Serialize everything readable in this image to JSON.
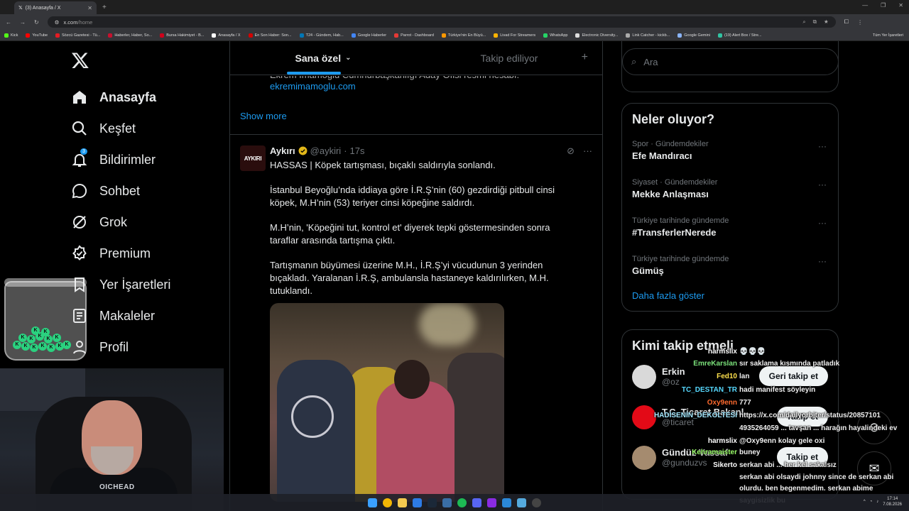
{
  "browser": {
    "tab_title": "(3) Anasayfa / X",
    "url_domain": "x.com",
    "url_path": "/home",
    "bookmarks": [
      {
        "label": "Kick",
        "color": "#53fc18"
      },
      {
        "label": "YouTube",
        "color": "#ff0000"
      },
      {
        "label": "Sözcü Gazetesi - Tü...",
        "color": "#e41b23"
      },
      {
        "label": "Haberler, Haber, So...",
        "color": "#c8102e"
      },
      {
        "label": "Bursa Hakimiyet - B...",
        "color": "#d0021b"
      },
      {
        "label": "Anasayfa / X",
        "color": "#ffffff"
      },
      {
        "label": "En Son Haber: Son...",
        "color": "#d40000"
      },
      {
        "label": "T24 - Gündem, Hab...",
        "color": "#0077b6"
      },
      {
        "label": "Google Haberler",
        "color": "#4285f4"
      },
      {
        "label": "Parrot - Dashboard",
        "color": "#e53935"
      },
      {
        "label": "Türkiye'nin En Büyü...",
        "color": "#ff9800"
      },
      {
        "label": "Livad For Streamers",
        "color": "#ffb300"
      },
      {
        "label": "WhatsApp",
        "color": "#25d366"
      },
      {
        "label": "Electronic Diversity...",
        "color": "#dddddd"
      },
      {
        "label": "Link Catcher - kickb...",
        "color": "#aaaaaa"
      },
      {
        "label": "Google Gemini",
        "color": "#8ab4f8"
      },
      {
        "label": "(19) Alert Box / Stre...",
        "color": "#31c3a2"
      }
    ],
    "all_bookmarks": "Tüm Yer İşaretleri"
  },
  "nav": {
    "items": [
      {
        "label": "Anasayfa",
        "icon": "home-icon"
      },
      {
        "label": "Keşfet",
        "icon": "search-icon"
      },
      {
        "label": "Bildirimler",
        "icon": "bell-icon",
        "badge": "3"
      },
      {
        "label": "Sohbet",
        "icon": "chat-icon"
      },
      {
        "label": "Grok",
        "icon": "grok-icon"
      },
      {
        "label": "Premium",
        "icon": "premium-icon"
      },
      {
        "label": "Yer İşaretleri",
        "icon": "bookmark-icon"
      },
      {
        "label": "Makaleler",
        "icon": "article-icon"
      },
      {
        "label": "Profil",
        "icon": "profile-icon"
      }
    ]
  },
  "feed": {
    "tabs": [
      "Sana özel",
      "Takip ediliyor"
    ],
    "prev_post_cut": "Ekrem İmamoğlu Cumhurbaşkanlığı Aday Ofisi resmi hesabı.",
    "prev_post_link": "ekremimamoglu.com",
    "show_more": "Show more",
    "post": {
      "avatar_text": "AYKIRI",
      "name": "Aykırı",
      "handle": "@aykiri",
      "time": "17s",
      "paragraphs": [
        "HASSAS | Köpek tartışması, bıçaklı saldırıyla sonlandı.",
        "İstanbul Beyoğlu’nda iddiaya göre İ.R.Ş’nin (60) gezdirdiği pitbull cinsi köpek, M.H’nin (53) teriyer cinsi köpeğine saldırdı.",
        "M.H’nin, 'Köpeğini tut, kontrol et' diyerek tepki göstermesinden sonra taraflar arasında tartışma çıktı.",
        "Tartışmanın büyümesi üzerine M.H., İ.R.Ş’yi vücudunun 3 yerinden bıçakladı. Yaralanan İ.R.Ş, ambulansla hastaneye kaldırılırken, M.H. tutuklandı."
      ]
    }
  },
  "sidebar": {
    "search_placeholder": "Ara",
    "trends_title": "Neler oluyor?",
    "trends": [
      {
        "category": "Spor · Gündemdekiler",
        "title": "Efe Mandıracı"
      },
      {
        "category": "Siyaset · Gündemdekiler",
        "title": "Mekke Anlaşması"
      },
      {
        "category": "Türkiye tarihinde gündemde",
        "title": "#TransferlerNerede"
      },
      {
        "category": "Türkiye tarihinde gündemde",
        "title": "Gümüş"
      }
    ],
    "trends_show_more": "Daha fazla göster",
    "follow_title": "Kimi takip etmeli",
    "follow": [
      {
        "name": "Erkin",
        "handle": "@oz",
        "button": "Geri takip et",
        "avatar_color": "#d9d9d9"
      },
      {
        "name": "T.C. Ticaret Bakanl...",
        "handle": "@ticaret",
        "button": "Takip et",
        "avatar_color": "#e30a17"
      },
      {
        "name": "Gündüz Vassaf",
        "handle": "@gunduzvs",
        "button": "Takip et",
        "avatar_color": "#a58b6f"
      }
    ]
  },
  "chat": [
    {
      "user": "harmslix",
      "color": "#ffffff",
      "text": "💀💀💀"
    },
    {
      "user": "EmreKarslan",
      "color": "#7be27b",
      "text": "sır saklama kısmında patladık"
    },
    {
      "user": "Fed10",
      "color": "#ffe14d",
      "text": "lan"
    },
    {
      "user": "TC_DESTAN_TR",
      "color": "#57d9ff",
      "text": "hadi manifest söyleyin"
    },
    {
      "user": "Oxy9enn",
      "color": "#ff6a2e",
      "text": "777"
    },
    {
      "user": "HADİSENİN_DEKOLTESİ",
      "color": "#a3e8ff",
      "text": "https://x.com/dailyorbiter/status/20857101"
    },
    {
      "user": "",
      "color": "#ffffff",
      "text": "4935264059 ... tavşan ... harağın hayalindeki ev"
    },
    {
      "user": "harmslix",
      "color": "#ffffff",
      "text": "@Oxy9enn kolay gele oxi"
    },
    {
      "user": "Kehramaister",
      "color": "#9bff6a",
      "text": "buney"
    },
    {
      "user": "Sikerto",
      "color": "#ffffff",
      "text": "serkan abi ... her kel sakalsız"
    },
    {
      "user": "",
      "color": "#ffffff",
      "text": "serkan abi olsaydi johnny since de serkan abi"
    },
    {
      "user": "",
      "color": "#ffffff",
      "text": "olurdu. ben begenmedim. serkan abime"
    },
    {
      "user": "",
      "color": "#ffffff",
      "text": "saygisizlik bu"
    }
  ],
  "stream": {
    "shirt_text": "OICHEAD",
    "jar_label": "K"
  },
  "taskbar": {
    "time": "17:14",
    "date": "7.08.2026"
  }
}
